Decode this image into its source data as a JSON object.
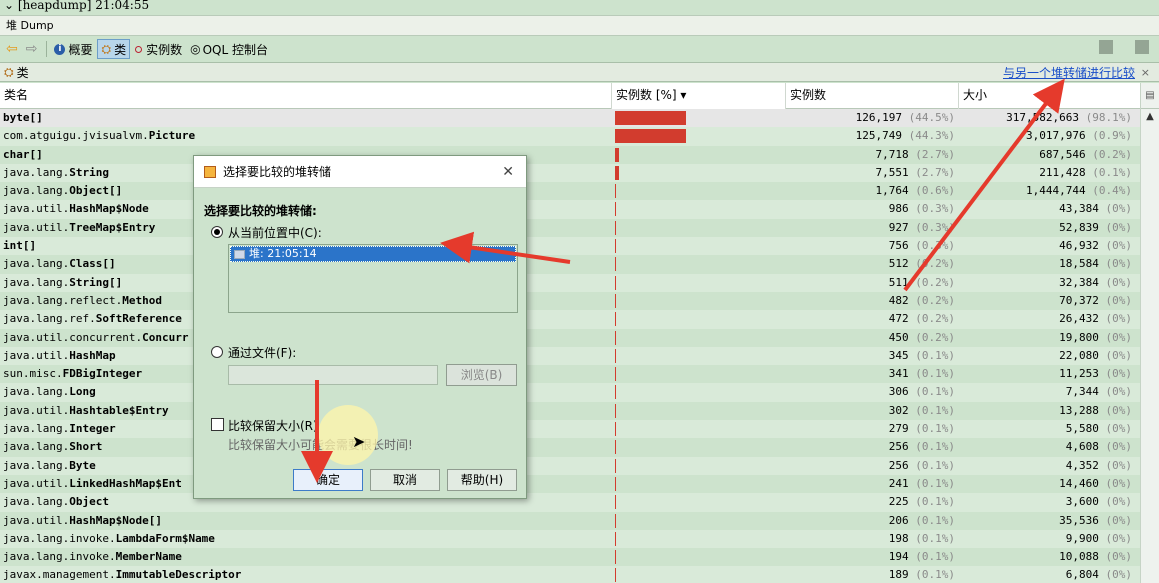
{
  "window": {
    "title": "[heapdump] 21:04:55",
    "tab_label": "堆 Dump"
  },
  "toolbar": {
    "summary_label": "概要",
    "classes_label": "类",
    "instances_label": "实例数",
    "oql_label": "OQL 控制台"
  },
  "class_header": {
    "title": "类",
    "compare_link": "与另一个堆转储进行比较",
    "close": "×"
  },
  "table": {
    "columns": [
      "类名",
      "实例数 [%]",
      "实例数",
      "大小"
    ],
    "sort_indicator": "▾",
    "rows": [
      {
        "name": "byte[]",
        "pkg": "",
        "cls": "byte[]",
        "pct_bar": 44.5,
        "count": "126,197",
        "count_pct": "(44.5%)",
        "size": "317,582,663",
        "size_pct": "(98.1%)",
        "sel": true
      },
      {
        "name": "com.atguigu.jvisualvm.Picture",
        "pkg": "com.atguigu.jvisualvm.",
        "cls": "Picture",
        "pct_bar": 44.3,
        "count": "125,749",
        "count_pct": "(44.3%)",
        "size": "3,017,976",
        "size_pct": "(0.9%)"
      },
      {
        "name": "char[]",
        "pkg": "",
        "cls": "char[]",
        "pct_bar": 2.7,
        "count": "7,718",
        "count_pct": "(2.7%)",
        "size": "687,546",
        "size_pct": "(0.2%)"
      },
      {
        "name": "java.lang.String",
        "pkg": "java.lang.",
        "cls": "String",
        "pct_bar": 2.7,
        "count": "7,551",
        "count_pct": "(2.7%)",
        "size": "211,428",
        "size_pct": "(0.1%)"
      },
      {
        "name": "java.lang.Object[]",
        "pkg": "java.lang.",
        "cls": "Object[]",
        "pct_bar": 0.6,
        "count": "1,764",
        "count_pct": "(0.6%)",
        "size": "1,444,744",
        "size_pct": "(0.4%)"
      },
      {
        "name": "java.util.HashMap$Node",
        "pkg": "java.util.",
        "cls": "HashMap$Node",
        "pct_bar": 0.3,
        "count": "986",
        "count_pct": "(0.3%)",
        "size": "43,384",
        "size_pct": "(0%)"
      },
      {
        "name": "java.util.TreeMap$Entry",
        "pkg": "java.util.",
        "cls": "TreeMap$Entry",
        "pct_bar": 0.3,
        "count": "927",
        "count_pct": "(0.3%)",
        "size": "52,839",
        "size_pct": "(0%)"
      },
      {
        "name": "int[]",
        "pkg": "",
        "cls": "int[]",
        "pct_bar": 0.3,
        "count": "756",
        "count_pct": "(0.3%)",
        "size": "46,932",
        "size_pct": "(0%)"
      },
      {
        "name": "java.lang.Class[]",
        "pkg": "java.lang.",
        "cls": "Class[]",
        "pct_bar": 0.2,
        "count": "512",
        "count_pct": "(0.2%)",
        "size": "18,584",
        "size_pct": "(0%)"
      },
      {
        "name": "java.lang.String[]",
        "pkg": "java.lang.",
        "cls": "String[]",
        "pct_bar": 0.2,
        "count": "511",
        "count_pct": "(0.2%)",
        "size": "32,384",
        "size_pct": "(0%)"
      },
      {
        "name": "java.lang.reflect.Method",
        "pkg": "java.lang.reflect.",
        "cls": "Method",
        "pct_bar": 0.2,
        "count": "482",
        "count_pct": "(0.2%)",
        "size": "70,372",
        "size_pct": "(0%)"
      },
      {
        "name": "java.lang.ref.SoftReference",
        "pkg": "java.lang.ref.",
        "cls": "SoftReference",
        "pct_bar": 0.2,
        "count": "472",
        "count_pct": "(0.2%)",
        "size": "26,432",
        "size_pct": "(0%)"
      },
      {
        "name": "java.util.concurrent.Concurr",
        "pkg": "java.util.concurrent.",
        "cls": "Concurr",
        "pct_bar": 0.2,
        "count": "450",
        "count_pct": "(0.2%)",
        "size": "19,800",
        "size_pct": "(0%)"
      },
      {
        "name": "java.util.HashMap",
        "pkg": "java.util.",
        "cls": "HashMap",
        "pct_bar": 0.1,
        "count": "345",
        "count_pct": "(0.1%)",
        "size": "22,080",
        "size_pct": "(0%)"
      },
      {
        "name": "sun.misc.FDBigInteger",
        "pkg": "sun.misc.",
        "cls": "FDBigInteger",
        "pct_bar": 0.1,
        "count": "341",
        "count_pct": "(0.1%)",
        "size": "11,253",
        "size_pct": "(0%)"
      },
      {
        "name": "java.lang.Long",
        "pkg": "java.lang.",
        "cls": "Long",
        "pct_bar": 0.1,
        "count": "306",
        "count_pct": "(0.1%)",
        "size": "7,344",
        "size_pct": "(0%)"
      },
      {
        "name": "java.util.Hashtable$Entry",
        "pkg": "java.util.",
        "cls": "Hashtable$Entry",
        "pct_bar": 0.1,
        "count": "302",
        "count_pct": "(0.1%)",
        "size": "13,288",
        "size_pct": "(0%)"
      },
      {
        "name": "java.lang.Integer",
        "pkg": "java.lang.",
        "cls": "Integer",
        "pct_bar": 0.1,
        "count": "279",
        "count_pct": "(0.1%)",
        "size": "5,580",
        "size_pct": "(0%)"
      },
      {
        "name": "java.lang.Short",
        "pkg": "java.lang.",
        "cls": "Short",
        "pct_bar": 0.1,
        "count": "256",
        "count_pct": "(0.1%)",
        "size": "4,608",
        "size_pct": "(0%)"
      },
      {
        "name": "java.lang.Byte",
        "pkg": "java.lang.",
        "cls": "Byte",
        "pct_bar": 0.1,
        "count": "256",
        "count_pct": "(0.1%)",
        "size": "4,352",
        "size_pct": "(0%)"
      },
      {
        "name": "java.util.LinkedHashMap$Ent",
        "pkg": "java.util.",
        "cls": "LinkedHashMap$Ent",
        "pct_bar": 0.1,
        "count": "241",
        "count_pct": "(0.1%)",
        "size": "14,460",
        "size_pct": "(0%)"
      },
      {
        "name": "java.lang.Object",
        "pkg": "java.lang.",
        "cls": "Object",
        "pct_bar": 0.1,
        "count": "225",
        "count_pct": "(0.1%)",
        "size": "3,600",
        "size_pct": "(0%)"
      },
      {
        "name": "java.util.HashMap$Node[]",
        "pkg": "java.util.",
        "cls": "HashMap$Node[]",
        "pct_bar": 0.1,
        "count": "206",
        "count_pct": "(0.1%)",
        "size": "35,536",
        "size_pct": "(0%)"
      },
      {
        "name": "java.lang.invoke.LambdaForm$Name",
        "pkg": "java.lang.invoke.",
        "cls": "LambdaForm$Name",
        "pct_bar": 0.1,
        "count": "198",
        "count_pct": "(0.1%)",
        "size": "9,900",
        "size_pct": "(0%)"
      },
      {
        "name": "java.lang.invoke.MemberName",
        "pkg": "java.lang.invoke.",
        "cls": "MemberName",
        "pct_bar": 0.1,
        "count": "194",
        "count_pct": "(0.1%)",
        "size": "10,088",
        "size_pct": "(0%)"
      },
      {
        "name": "javax.management.ImmutableDescriptor",
        "pkg": "javax.management.",
        "cls": "ImmutableDescriptor",
        "pct_bar": 0.1,
        "count": "189",
        "count_pct": "(0.1%)",
        "size": "6,804",
        "size_pct": "(0%)"
      }
    ]
  },
  "dialog": {
    "title": "选择要比较的堆转储",
    "heading": "选择要比较的堆转储:",
    "option_current": "从当前位置中(C):",
    "list_item": "堆: 21:05:14",
    "option_file": "通过文件(F):",
    "file_value": "",
    "browse_label": "浏览(B)",
    "compare_retained_label": "比较保留大小(R)",
    "hint_text": "比较保留大小可能会需要很长时间!",
    "ok_label": "确定",
    "cancel_label": "取消",
    "help_label": "帮助(H)"
  },
  "colors": {
    "accent": "#d23c2e",
    "selection": "#2b74c9",
    "background": "#cde3cd",
    "link": "#1a4fc9"
  }
}
